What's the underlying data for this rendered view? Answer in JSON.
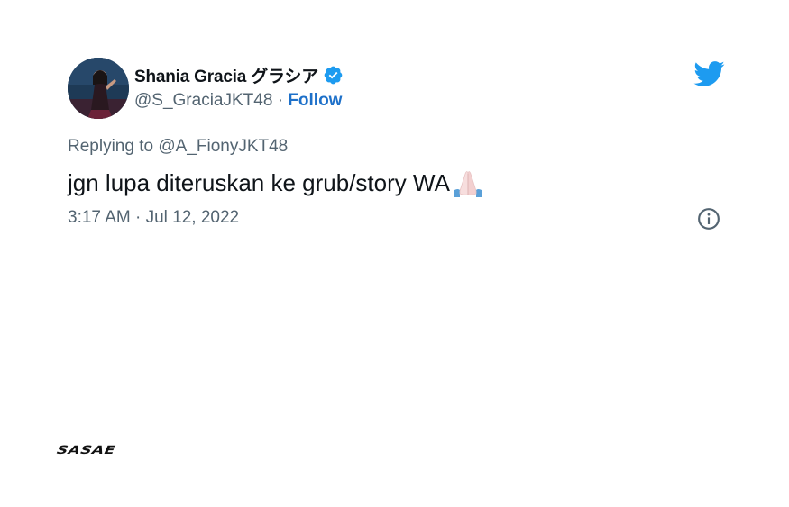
{
  "user": {
    "display_name": "Shania Gracia グラシア",
    "handle": "@S_GraciaJKT48",
    "separator": "·",
    "follow_label": "Follow",
    "verified": true
  },
  "reply": {
    "prefix": "Replying to",
    "mention": "@A_FionyJKT48"
  },
  "tweet": {
    "text": "jgn lupa diteruskan ke grub/story WA",
    "emoji": "folded-hands-icon"
  },
  "meta": {
    "timestamp": "3:17 AM · Jul 12, 2022"
  },
  "icons": {
    "brand": "twitter-bird-icon",
    "info": "info-icon",
    "verified": "verified-badge-icon"
  },
  "watermark": {
    "text": "SASAE"
  },
  "colors": {
    "twitter_blue": "#1d9bf0",
    "link_blue": "#1d70c9",
    "secondary_text": "#536471",
    "primary_text": "#0f1419"
  }
}
